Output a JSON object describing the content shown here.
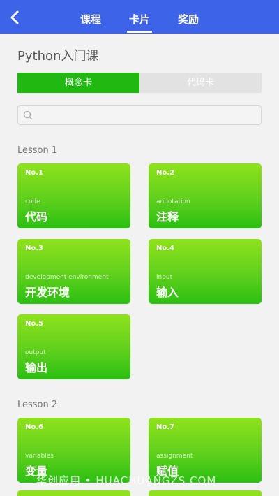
{
  "nav": {
    "tabs": [
      {
        "label": "课程"
      },
      {
        "label": "卡片"
      },
      {
        "label": "奖励"
      }
    ]
  },
  "page": {
    "title": "Python入门课"
  },
  "segment": {
    "active": "概念卡",
    "inactive": "代码卡"
  },
  "search": {
    "placeholder": ""
  },
  "lessons": [
    {
      "label": "Lesson 1",
      "cards": [
        {
          "no": "No.1",
          "en": "code",
          "zh": "代码"
        },
        {
          "no": "No.2",
          "en": "annotation",
          "zh": "注释"
        },
        {
          "no": "No.3",
          "en": "development environment",
          "zh": "开发环境"
        },
        {
          "no": "No.4",
          "en": "input",
          "zh": "输入"
        },
        {
          "no": "No.5",
          "en": "output",
          "zh": "输出"
        }
      ]
    },
    {
      "label": "Lesson 2",
      "cards": [
        {
          "no": "No.6",
          "en": "variables",
          "zh": "变量"
        },
        {
          "no": "No.7",
          "en": "assignment",
          "zh": "赋值"
        }
      ]
    }
  ],
  "watermark": "华创应用 • HUACHUANGZS.COM"
}
